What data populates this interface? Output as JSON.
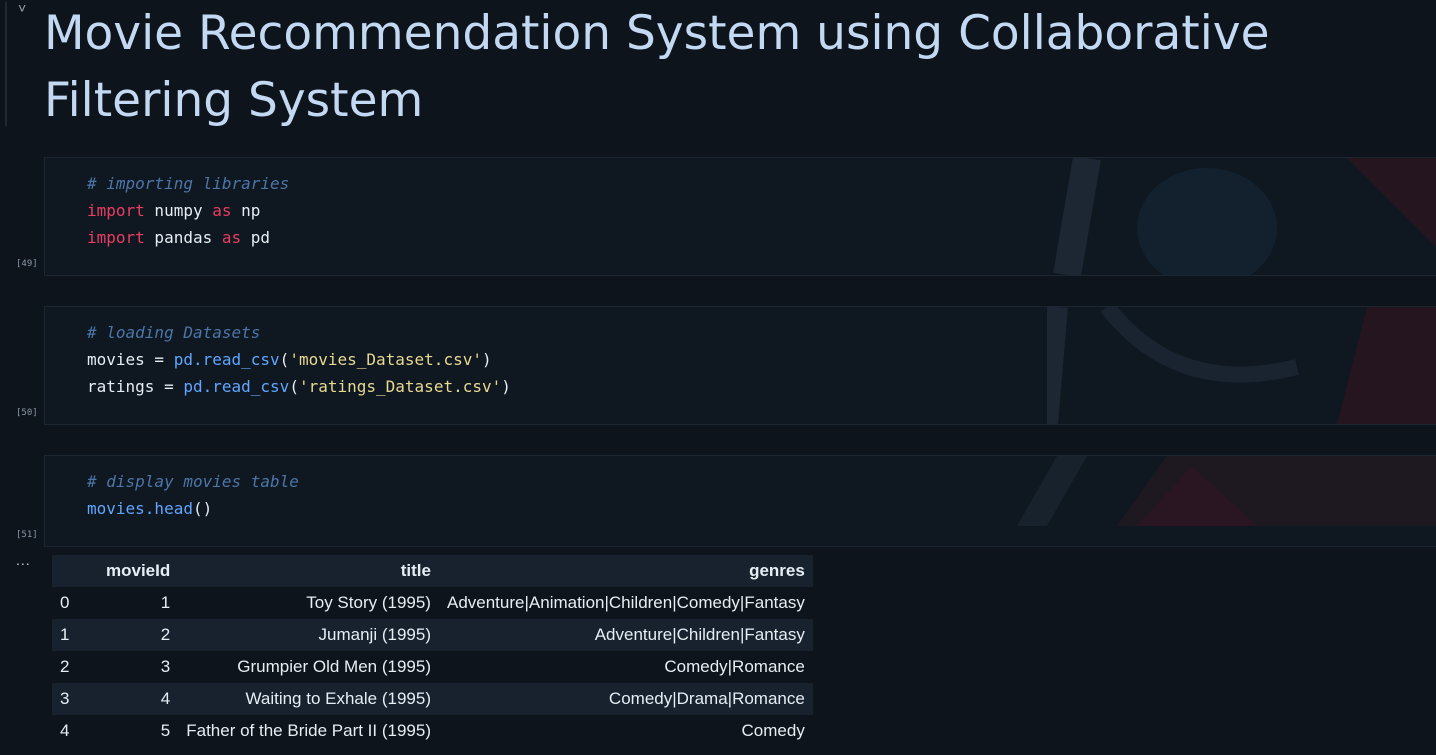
{
  "markdown": {
    "title": "Movie Recommendation System using Collaborative Filtering System",
    "collapse_glyph": "˅"
  },
  "cells": [
    {
      "exec_count": "[49]",
      "lines": [
        {
          "comment": "# importing libraries"
        },
        {
          "kw1": "import",
          "t1": " numpy ",
          "kw2": "as",
          "t2": " np"
        },
        {
          "kw1": "import",
          "t1": " pandas ",
          "kw2": "as",
          "t2": " pd"
        }
      ]
    },
    {
      "exec_count": "[50]",
      "lines": [
        {
          "comment": "# loading Datasets"
        },
        {
          "var": "movies",
          "op": " = ",
          "fn": "pd.read_csv",
          "open": "(",
          "str": "'movies_Dataset.csv'",
          "close": ")"
        },
        {
          "var": "ratings",
          "op": " = ",
          "fn": "pd.read_csv",
          "open": "(",
          "str": "'ratings_Dataset.csv'",
          "close": ")"
        }
      ]
    },
    {
      "exec_count": "[51]",
      "lines": [
        {
          "comment": "# display movies table"
        },
        {
          "fn": "movies.head",
          "paren": "()"
        }
      ]
    }
  ],
  "output": {
    "more_glyph": "...",
    "columns": [
      "",
      "movieId",
      "title",
      "genres"
    ],
    "rows": [
      [
        "0",
        "1",
        "Toy Story (1995)",
        "Adventure|Animation|Children|Comedy|Fantasy"
      ],
      [
        "1",
        "2",
        "Jumanji (1995)",
        "Adventure|Children|Fantasy"
      ],
      [
        "2",
        "3",
        "Grumpier Old Men (1995)",
        "Comedy|Romance"
      ],
      [
        "3",
        "4",
        "Waiting to Exhale (1995)",
        "Comedy|Drama|Romance"
      ],
      [
        "4",
        "5",
        "Father of the Bride Part II (1995)",
        "Comedy"
      ]
    ]
  },
  "colors": {
    "background": "#0e141b",
    "heading": "#c3d8f2",
    "keyword": "#e83e61",
    "function": "#61a6ff",
    "string": "#e8d992",
    "comment": "#4c76a8"
  }
}
